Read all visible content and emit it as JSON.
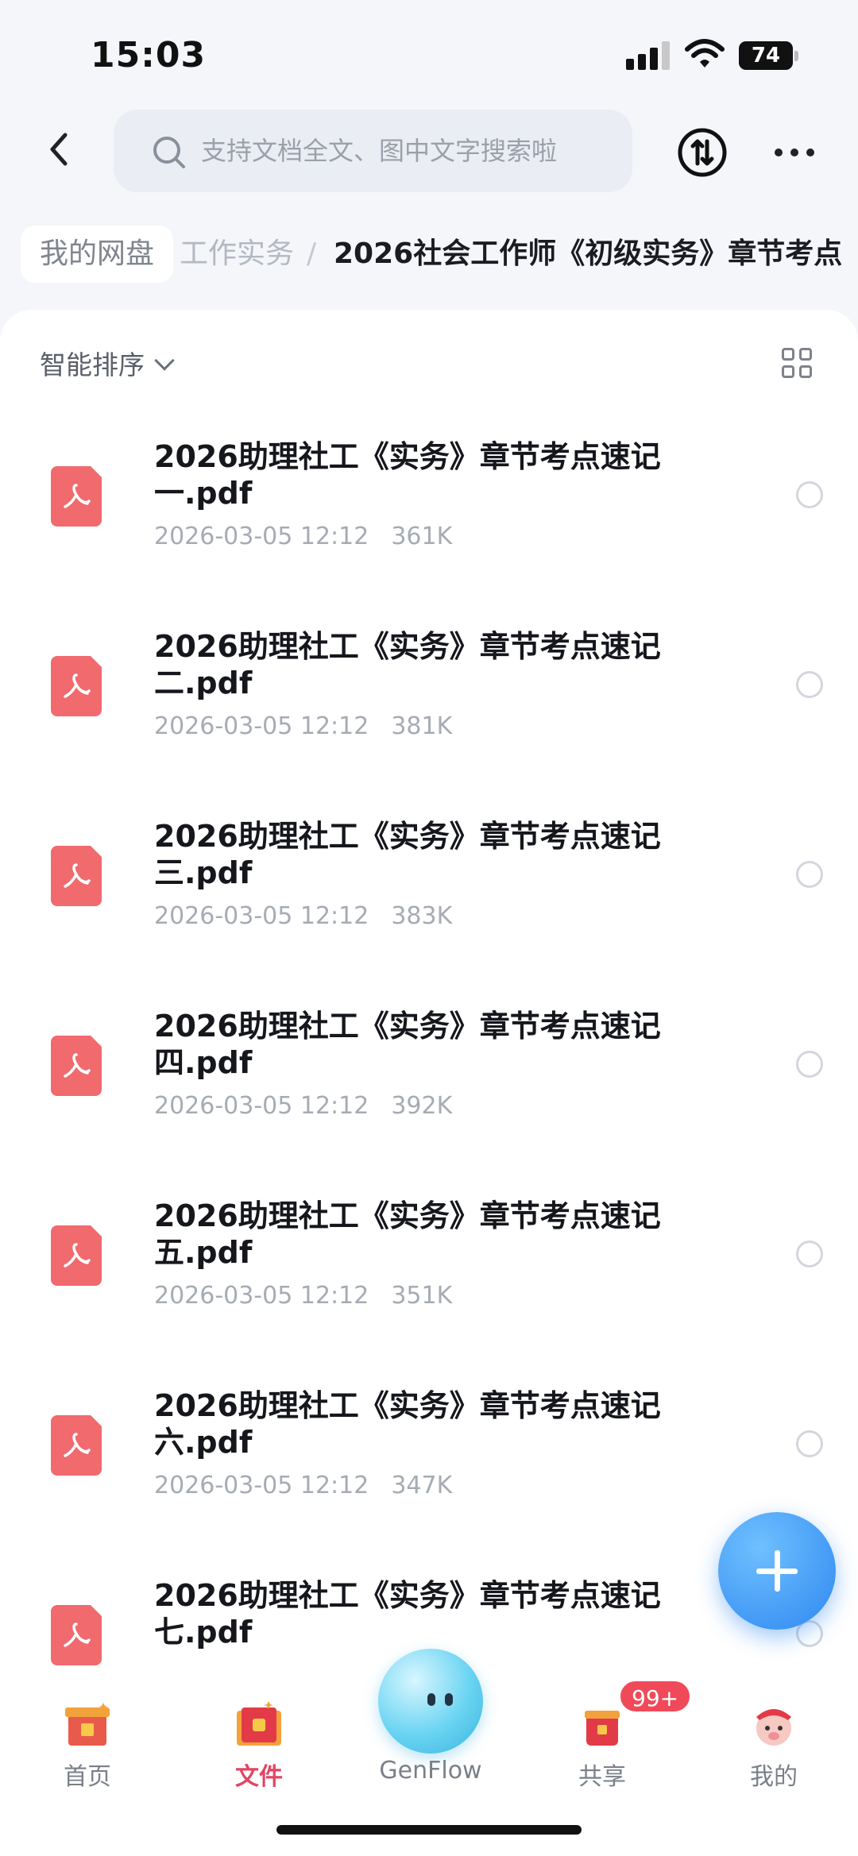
{
  "status_bar": {
    "time": "15:03",
    "battery": "74"
  },
  "search": {
    "placeholder": "支持文档全文、图中文字搜索啦"
  },
  "breadcrumb": {
    "root": "我的网盘",
    "middle": "工作实务",
    "separator": "/",
    "current": "2026社会工作师《初级实务》章节考点"
  },
  "toolbar": {
    "sort_label": "智能排序"
  },
  "files": [
    {
      "name_line1": "2026助理社工《实务》章节考点速记",
      "name_line2": "一.pdf",
      "date": "2026-03-05 12:12",
      "size": "361K"
    },
    {
      "name_line1": "2026助理社工《实务》章节考点速记",
      "name_line2": "二.pdf",
      "date": "2026-03-05 12:12",
      "size": "381K"
    },
    {
      "name_line1": "2026助理社工《实务》章节考点速记",
      "name_line2": "三.pdf",
      "date": "2026-03-05 12:12",
      "size": "383K"
    },
    {
      "name_line1": "2026助理社工《实务》章节考点速记",
      "name_line2": "四.pdf",
      "date": "2026-03-05 12:12",
      "size": "392K"
    },
    {
      "name_line1": "2026助理社工《实务》章节考点速记",
      "name_line2": "五.pdf",
      "date": "2026-03-05 12:12",
      "size": "351K"
    },
    {
      "name_line1": "2026助理社工《实务》章节考点速记",
      "name_line2": "六.pdf",
      "date": "2026-03-05 12:12",
      "size": "347K"
    },
    {
      "name_line1": "2026助理社工《实务》章节考点速记",
      "name_line2": "七.pdf",
      "date": "",
      "size": ""
    }
  ],
  "tab_bar": {
    "home": "首页",
    "files": "文件",
    "genflow": "GenFlow",
    "share": "共享",
    "share_badge": "99+",
    "me": "我的"
  },
  "colors": {
    "accent": "#e24563",
    "pdf": "#f06a6e",
    "fab": "#2f88f0"
  }
}
